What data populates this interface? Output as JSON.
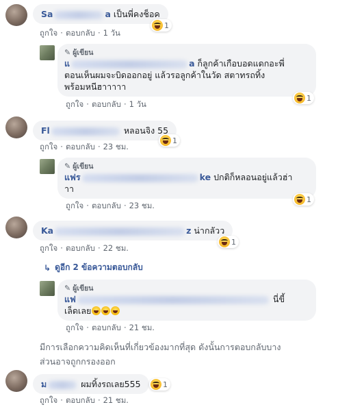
{
  "actions": {
    "like": "ถูกใจ",
    "reply": "ตอบกลับ",
    "sep": "·"
  },
  "author_badge": "ผู้เขียน",
  "comments": [
    {
      "name_start": "Sa",
      "name_end": "a",
      "text": "เป็นพี่คงช็อค",
      "reactions": "1",
      "time": "1 วัน"
    },
    {
      "name_start": "แ",
      "name_end": "a",
      "text_line1": "ก็ลูกค้าเกือบอดแดกอะพี่",
      "text_line2": "ตอนเห็นผมจะบิดออกอยู่ แล้วรอลูกค้าในวัด สตาทรถทิ้ง",
      "text_line3": "พร้อมหนีฮาาาาา",
      "reactions": "1",
      "time": "1 วัน"
    },
    {
      "name_start": "Fl",
      "name_end": "",
      "text": "หลอนจิง 55",
      "reactions": "1",
      "time": "23 ชม."
    },
    {
      "name_start": "แฟร",
      "name_end": "ke",
      "text_line1": "ปกติก็หลอนอยู่แล้วฮ่า",
      "text_line2": "าา",
      "reactions": "1",
      "time": "23 ชม."
    },
    {
      "name_start": "Ka",
      "name_end": "z",
      "text": "น่ากลัวว",
      "reactions": "1",
      "time": "22 ชม."
    },
    {
      "name_start": "แฟ",
      "name_end": "",
      "text_line1": "นี่ขี้",
      "text_line2": "เล็ดเลย",
      "time": "21 ชม."
    },
    {
      "name_start": "ม",
      "name_end": "",
      "text": "ผมทิ้งรถเลย555",
      "reactions": "1",
      "time": "21 ชม."
    }
  ],
  "more_replies": "ดูอีก 2 ข้อความตอบกลับ",
  "notice_line1": "มีการเลือกความคิดเห็นที่เกี่ยวข้องมากที่สุด ดังนั้นการตอบกลับบาง",
  "notice_line2": "ส่วนอาจถูกกรองออก",
  "icons": {
    "reaction": "haha-icon",
    "author": "pen-icon",
    "reply_arrow": "reply-arrow-icon"
  },
  "colors": {
    "name": "#385898",
    "bubble": "#f2f3f5",
    "meta": "#606770"
  }
}
